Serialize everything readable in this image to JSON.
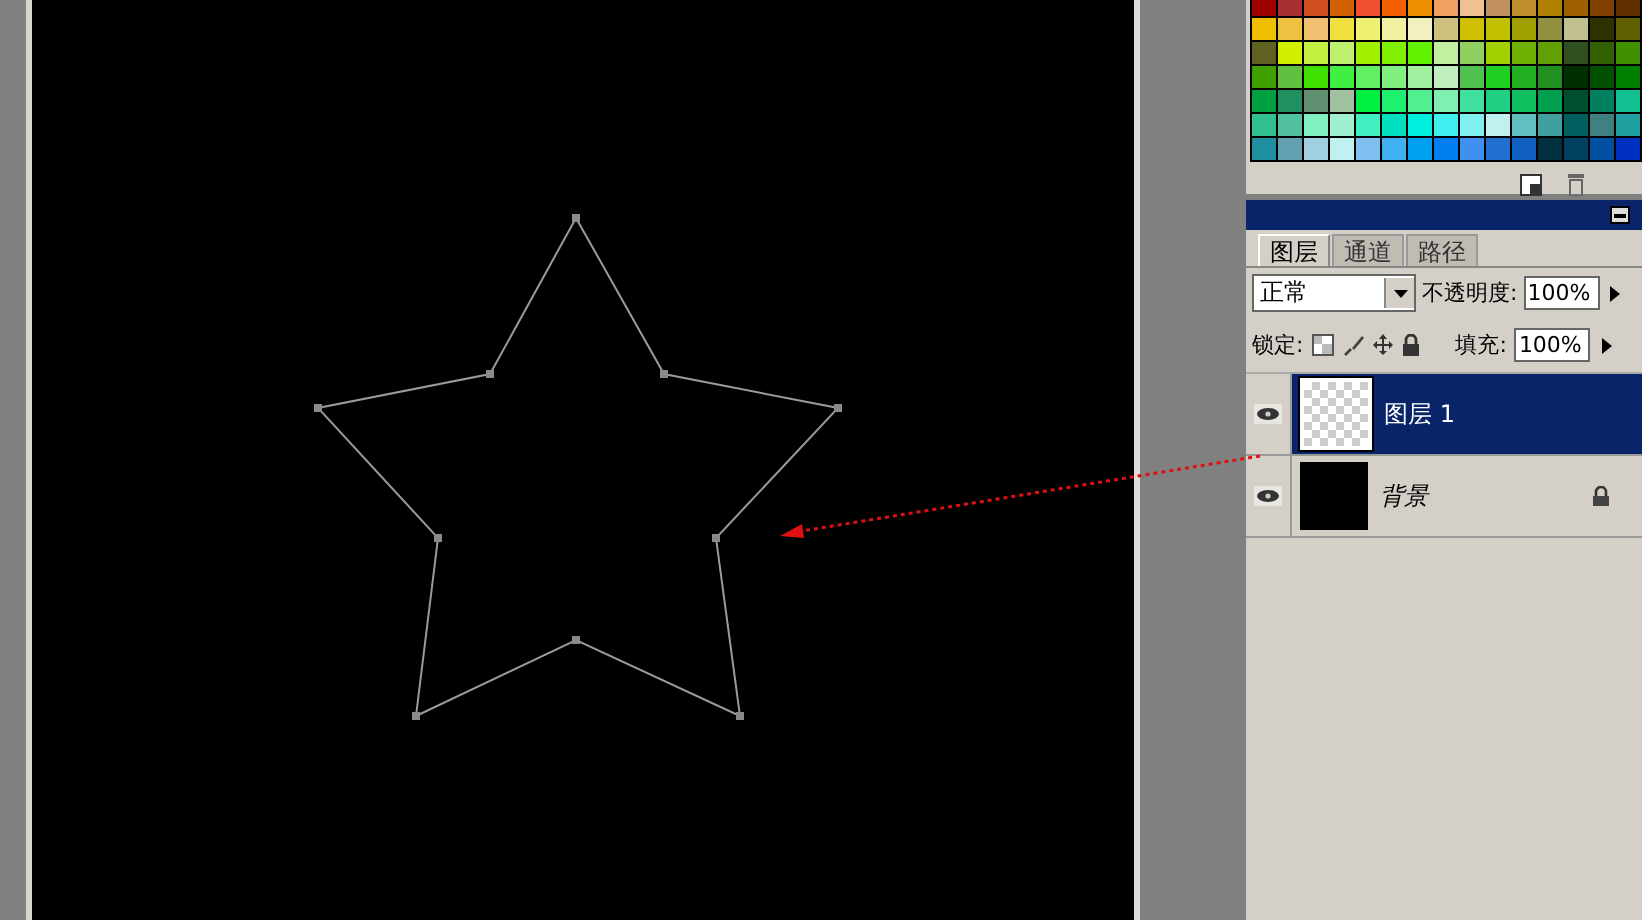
{
  "layers_panel": {
    "tabs": [
      {
        "label": "图层",
        "selected": true
      },
      {
        "label": "通道",
        "selected": false
      },
      {
        "label": "路径",
        "selected": false
      }
    ],
    "blend_mode": "正常",
    "opacity_label": "不透明度:",
    "opacity": "100%",
    "lock_label": "锁定:",
    "fill_label": "填充:",
    "fill": "100%",
    "layers": [
      {
        "name": "图层 1",
        "kind": "transparent",
        "selected": true,
        "visible": true,
        "locked": false
      },
      {
        "name": "背景",
        "kind": "background",
        "selected": false,
        "visible": true,
        "locked": true
      }
    ]
  }
}
